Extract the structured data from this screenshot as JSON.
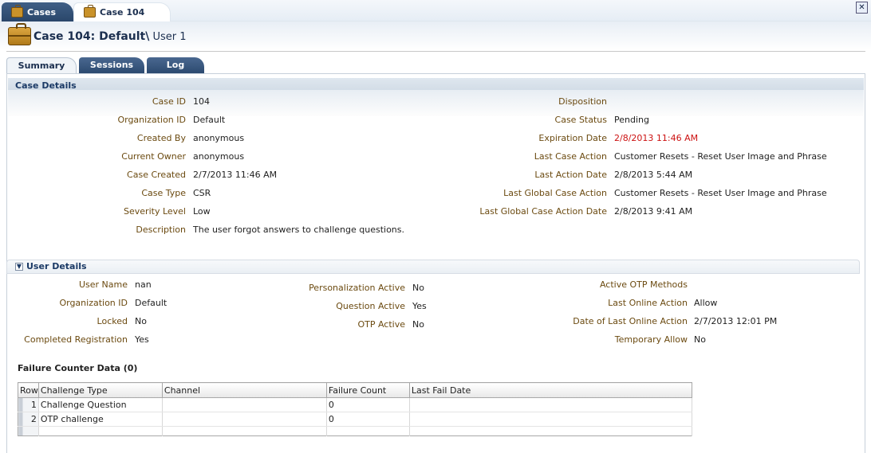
{
  "doc_tabs": [
    {
      "label": "Cases",
      "icon": "briefcase-icon"
    },
    {
      "label": "Case 104",
      "icon": "briefcase-icon"
    }
  ],
  "header": {
    "title_bold": "Case 104: Default",
    "title_sep": "\\",
    "title_user": " User 1",
    "icon": "briefcase-icon"
  },
  "sub_tabs": [
    "Summary",
    "Sessions",
    "Log"
  ],
  "case_details": {
    "heading": "Case Details",
    "left": [
      {
        "label": "Case ID",
        "value": "104"
      },
      {
        "label": "Organization ID",
        "value": "Default"
      },
      {
        "label": "Created By",
        "value": "anonymous"
      },
      {
        "label": "Current Owner",
        "value": "anonymous"
      },
      {
        "label": "Case Created",
        "value": "2/7/2013 11:46 AM"
      },
      {
        "label": "Case Type",
        "value": "CSR"
      },
      {
        "label": "Severity Level",
        "value": "Low"
      },
      {
        "label": "Description",
        "value": "The user forgot answers to challenge questions."
      }
    ],
    "right": [
      {
        "label": "Disposition",
        "value": ""
      },
      {
        "label": "Case Status",
        "value": "Pending"
      },
      {
        "label": "Expiration Date",
        "value": "2/8/2013 11:46 AM"
      },
      {
        "label": "Last Case Action",
        "value": "Customer Resets - Reset User Image and Phrase"
      },
      {
        "label": "Last Action Date",
        "value": "2/8/2013 5:44 AM"
      },
      {
        "label": "Last Global Case Action",
        "value": "Customer Resets - Reset User Image and Phrase"
      },
      {
        "label": "Last Global Case Action Date",
        "value": "2/8/2013 9:41 AM"
      }
    ]
  },
  "user_details": {
    "heading": "User Details",
    "col1": [
      {
        "label": "User Name",
        "value": "nan"
      },
      {
        "label": "Organization ID",
        "value": "Default"
      },
      {
        "label": "Locked",
        "value": "No"
      },
      {
        "label": "Completed Registration",
        "value": "Yes"
      }
    ],
    "col2": [
      {
        "label": "Personalization Active",
        "value": "No"
      },
      {
        "label": "Question Active",
        "value": "Yes"
      },
      {
        "label": "OTP Active",
        "value": "No"
      }
    ],
    "col3": [
      {
        "label": "Active OTP Methods",
        "value": ""
      },
      {
        "label": "Last Online Action",
        "value": "Allow"
      },
      {
        "label": "Date of Last Online Action",
        "value": "2/7/2013 12:01 PM"
      },
      {
        "label": "Temporary Allow",
        "value": "No"
      }
    ]
  },
  "failure_counter": {
    "title": "Failure Counter Data (0)",
    "columns": [
      "Row",
      "Challenge Type",
      "Channel",
      "Failure Count",
      "Last Fail Date"
    ],
    "rows": [
      {
        "row": "1",
        "challenge_type": "Challenge Question",
        "channel": "",
        "failure_count": "0",
        "last_fail_date": ""
      },
      {
        "row": "2",
        "challenge_type": "OTP challenge",
        "channel": "",
        "failure_count": "0",
        "last_fail_date": ""
      }
    ]
  },
  "colors": {
    "label": "#6b4a10",
    "expiration": "#cc1111",
    "tab_dark": "#2c4a70",
    "section_text": "#1b3a66"
  }
}
